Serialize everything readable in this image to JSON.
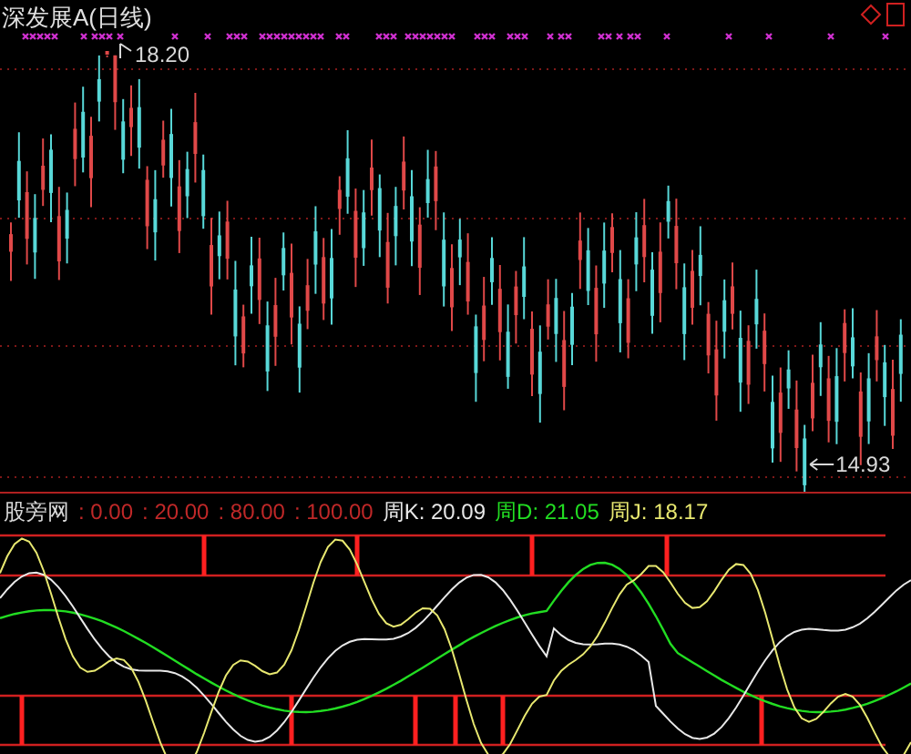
{
  "chart_title": "深发展A(日线)",
  "high_label": "18.20",
  "low_label": "14.93",
  "indicator": {
    "name": "股旁网",
    "levels": [
      ": 0.00",
      ": 20.00",
      ": 80.00",
      ": 100.00"
    ],
    "readings": [
      {
        "label": "周K:",
        "value": "20.09",
        "color": "#e8e8e8"
      },
      {
        "label": "周D:",
        "value": "21.05",
        "color": "#22dd22"
      },
      {
        "label": "周J:",
        "value": "18.17",
        "color": "#e8e870"
      }
    ]
  }
}
